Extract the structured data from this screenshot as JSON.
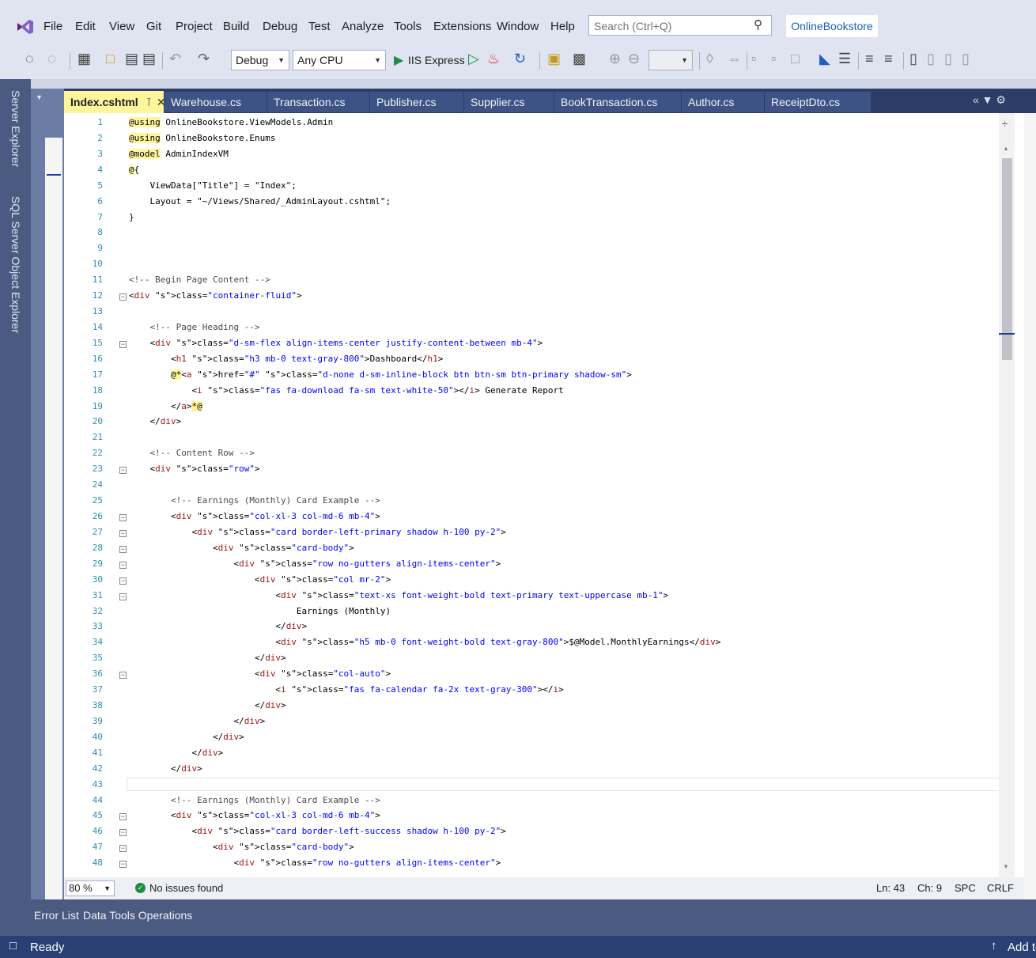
{
  "menu": [
    "File",
    "Edit",
    "View",
    "Git",
    "Project",
    "Build",
    "Debug",
    "Test",
    "Analyze",
    "Tools",
    "Extensions",
    "Window",
    "Help"
  ],
  "search_placeholder": "Search (Ctrl+Q)",
  "solution_name": "OnlineBookstore",
  "toolbar": {
    "configuration": "Debug",
    "platform": "Any CPU",
    "run_target": "IIS Express"
  },
  "side_tabs": [
    "Server Explorer",
    "SQL Server Object Explorer"
  ],
  "tabs": {
    "active": "Index.cshtml",
    "others": [
      "Warehouse.cs",
      "Transaction.cs",
      "Publisher.cs",
      "Supplier.cs",
      "BookTransaction.cs",
      "Author.cs",
      "ReceiptDto.cs"
    ]
  },
  "code_lines": [
    "@using OnlineBookstore.ViewModels.Admin",
    "@using OnlineBookstore.Enums",
    "@model AdminIndexVM",
    "@{",
    "    ViewData[\"Title\"] = \"Index\";",
    "    Layout = \"~/Views/Shared/_AdminLayout.cshtml\";",
    "}",
    "",
    "",
    "",
    "<!-- Begin Page Content -->",
    "<div class=\"container-fluid\">",
    "",
    "    <!-- Page Heading -->",
    "    <div class=\"d-sm-flex align-items-center justify-content-between mb-4\">",
    "        <h1 class=\"h3 mb-0 text-gray-800\">Dashboard</h1>",
    "        @*<a href=\"#\" class=\"d-none d-sm-inline-block btn btn-sm btn-primary shadow-sm\">",
    "            <i class=\"fas fa-download fa-sm text-white-50\"></i> Generate Report",
    "        </a>*@",
    "    </div>",
    "",
    "    <!-- Content Row -->",
    "    <div class=\"row\">",
    "",
    "        <!-- Earnings (Monthly) Card Example -->",
    "        <div class=\"col-xl-3 col-md-6 mb-4\">",
    "            <div class=\"card border-left-primary shadow h-100 py-2\">",
    "                <div class=\"card-body\">",
    "                    <div class=\"row no-gutters align-items-center\">",
    "                        <div class=\"col mr-2\">",
    "                            <div class=\"text-xs font-weight-bold text-primary text-uppercase mb-1\">",
    "                                Earnings (Monthly)",
    "                            </div>",
    "                            <div class=\"h5 mb-0 font-weight-bold text-gray-800\">$@Model.MonthlyEarnings</div>",
    "                        </div>",
    "                        <div class=\"col-auto\">",
    "                            <i class=\"fas fa-calendar fa-2x text-gray-300\"></i>",
    "                        </div>",
    "                    </div>",
    "                </div>",
    "            </div>",
    "        </div>",
    "",
    "        <!-- Earnings (Monthly) Card Example -->",
    "        <div class=\"col-xl-3 col-md-6 mb-4\">",
    "            <div class=\"card border-left-success shadow h-100 py-2\">",
    "                <div class=\"card-body\">",
    "                    <div class=\"row no-gutters align-items-center\">"
  ],
  "status": {
    "zoom": "80 %",
    "issues": "No issues found",
    "line": "Ln: 43",
    "col": "Ch: 9",
    "spc": "SPC",
    "eol": "CRLF"
  },
  "bottom_tabs": [
    "Error List",
    "Data Tools Operations"
  ],
  "statusbar": {
    "ready": "Ready",
    "add_to": "Add to"
  }
}
